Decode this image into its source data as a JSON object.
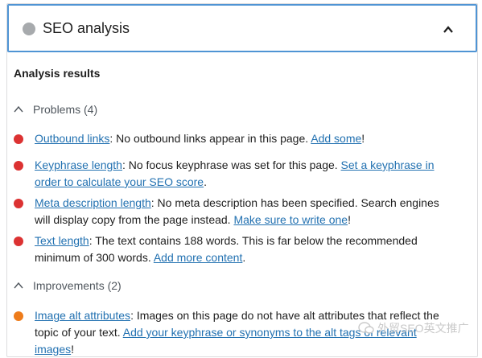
{
  "header": {
    "title": "SEO analysis",
    "status_color": "#a7aaad"
  },
  "results_heading": "Analysis results",
  "problems": {
    "label": "Problems (4)",
    "items": [
      {
        "link": "Outbound links",
        "text": ": No outbound links appear in this page. ",
        "action": "Add some",
        "end": "!"
      },
      {
        "link": "Keyphrase length",
        "text": ": No focus keyphrase was set for this page. ",
        "action": "Set a keyphrase in order to calculate your SEO score",
        "end": "."
      },
      {
        "link": "Meta description length",
        "text": ": No meta description has been specified. Search engines will display copy from the page instead. ",
        "action": "Make sure to write one",
        "end": "!"
      },
      {
        "link": "Text length",
        "text": ": The text contains 188 words. This is far below the recommended minimum of 300 words. ",
        "action": "Add more content",
        "end": "."
      }
    ]
  },
  "improvements": {
    "label": "Improvements (2)",
    "items": [
      {
        "link": "Image alt attributes",
        "text": ": Images on this page do not have alt attributes that reflect the topic of your text. ",
        "action": "Add your keyphrase or synonyms to the alt tags of relevant images",
        "end": "!"
      }
    ]
  },
  "colors": {
    "problem": "#dc3232",
    "improvement": "#ee7c1b",
    "link": "#2271b1"
  },
  "watermark": "外贸SEO英文推广"
}
